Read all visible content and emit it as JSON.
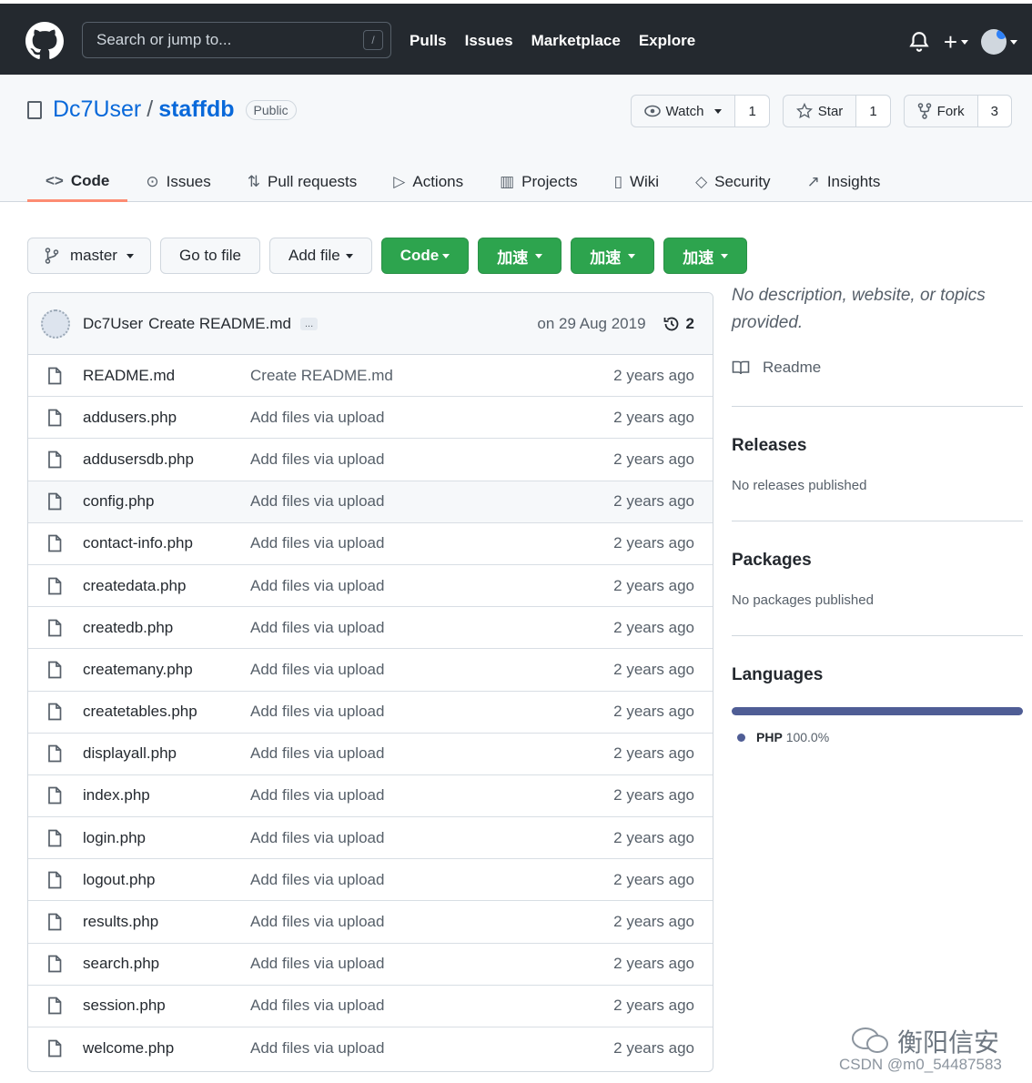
{
  "topbar": {
    "search_placeholder": "Search or jump to...",
    "search_shortcut": "/",
    "nav": [
      "Pulls",
      "Issues",
      "Marketplace",
      "Explore"
    ]
  },
  "repo": {
    "owner": "Dc7User",
    "separator": "/",
    "name": "staffdb",
    "visibility": "Public",
    "watch_label": "Watch",
    "watch_count": "1",
    "star_label": "Star",
    "star_count": "1",
    "fork_label": "Fork",
    "fork_count": "3"
  },
  "tabs": [
    {
      "label": "Code",
      "icon": "code-icon"
    },
    {
      "label": "Issues",
      "icon": "issue-icon"
    },
    {
      "label": "Pull requests",
      "icon": "pull-request-icon"
    },
    {
      "label": "Actions",
      "icon": "play-icon"
    },
    {
      "label": "Projects",
      "icon": "project-icon"
    },
    {
      "label": "Wiki",
      "icon": "book-icon"
    },
    {
      "label": "Security",
      "icon": "shield-icon"
    },
    {
      "label": "Insights",
      "icon": "graph-icon"
    }
  ],
  "toolbar": {
    "branch": "master",
    "goto": "Go to file",
    "add": "Add file",
    "code": "Code",
    "speed1": "加速",
    "speed2": "加速",
    "speed3": "加速"
  },
  "commit": {
    "author": "Dc7User",
    "message": "Create README.md",
    "ellipsis": "...",
    "date": "on 29 Aug 2019",
    "history_count": "2"
  },
  "files": [
    {
      "name": "README.md",
      "message": "Create README.md",
      "time": "2 years ago"
    },
    {
      "name": "addusers.php",
      "message": "Add files via upload",
      "time": "2 years ago"
    },
    {
      "name": "addusersdb.php",
      "message": "Add files via upload",
      "time": "2 years ago"
    },
    {
      "name": "config.php",
      "message": "Add files via upload",
      "time": "2 years ago"
    },
    {
      "name": "contact-info.php",
      "message": "Add files via upload",
      "time": "2 years ago"
    },
    {
      "name": "createdata.php",
      "message": "Add files via upload",
      "time": "2 years ago"
    },
    {
      "name": "createdb.php",
      "message": "Add files via upload",
      "time": "2 years ago"
    },
    {
      "name": "createmany.php",
      "message": "Add files via upload",
      "time": "2 years ago"
    },
    {
      "name": "createtables.php",
      "message": "Add files via upload",
      "time": "2 years ago"
    },
    {
      "name": "displayall.php",
      "message": "Add files via upload",
      "time": "2 years ago"
    },
    {
      "name": "index.php",
      "message": "Add files via upload",
      "time": "2 years ago"
    },
    {
      "name": "login.php",
      "message": "Add files via upload",
      "time": "2 years ago"
    },
    {
      "name": "logout.php",
      "message": "Add files via upload",
      "time": "2 years ago"
    },
    {
      "name": "results.php",
      "message": "Add files via upload",
      "time": "2 years ago"
    },
    {
      "name": "search.php",
      "message": "Add files via upload",
      "time": "2 years ago"
    },
    {
      "name": "session.php",
      "message": "Add files via upload",
      "time": "2 years ago"
    },
    {
      "name": "welcome.php",
      "message": "Add files via upload",
      "time": "2 years ago"
    }
  ],
  "sidebar": {
    "about": "No description, website, or topics provided.",
    "readme": "Readme",
    "releases_title": "Releases",
    "releases_sub": "No releases published",
    "packages_title": "Packages",
    "packages_sub": "No packages published",
    "languages_title": "Languages",
    "language_name": "PHP",
    "language_pct": "100.0%",
    "language_color": "#4f5d95"
  },
  "watermark": {
    "line1": "衡阳信安",
    "line2": "CSDN @m0_54487583"
  }
}
